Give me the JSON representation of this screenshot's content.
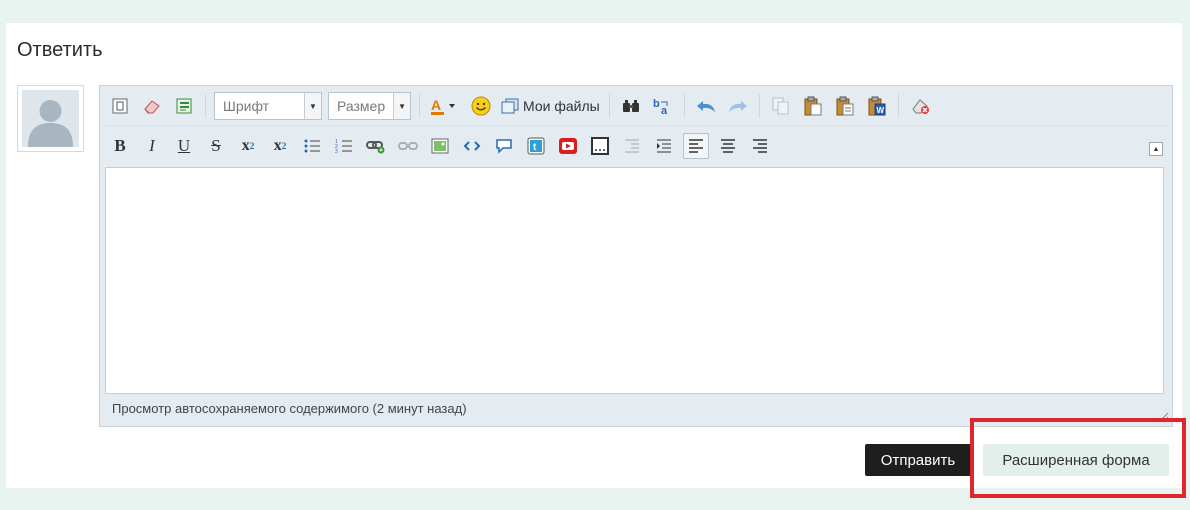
{
  "reply": {
    "title": "Ответить"
  },
  "editor": {
    "font_combo": "Шрифт",
    "size_combo": "Размер",
    "my_files": "Мои файлы",
    "status": "Просмотр автосохраняемого содержимого (2 минут назад)",
    "bold": "B",
    "italic": "I",
    "underline": "U",
    "strike": "S",
    "subscript": "x",
    "subscript_mark": "2",
    "superscript": "x",
    "superscript_mark": "2"
  },
  "actions": {
    "send_label": "Отправить",
    "advanced_label": "Расширенная форма"
  },
  "colors": {
    "background": "#e9f3ef",
    "send_button": "#1e1e1e",
    "advanced_button": "#e3efea",
    "highlight_box": "#e0262c"
  },
  "icons": [
    "source-icon",
    "eraser-icon",
    "template-icon",
    "font-color-icon",
    "smiley-icon",
    "files-icon",
    "find-icon",
    "replace-icon",
    "undo-icon",
    "redo-icon",
    "copy-icon",
    "paste-icon",
    "paste-text-icon",
    "paste-word-icon",
    "remove-format-icon",
    "bulleted-list-icon",
    "numbered-list-icon",
    "link-icon",
    "unlink-icon",
    "image-icon",
    "code-icon",
    "quote-icon",
    "tweet-icon",
    "youtube-icon",
    "spoiler-icon",
    "outdent-icon",
    "indent-icon",
    "align-left-icon",
    "align-center-icon",
    "align-right-icon",
    "collapse-icon",
    "avatar-placeholder-icon"
  ]
}
